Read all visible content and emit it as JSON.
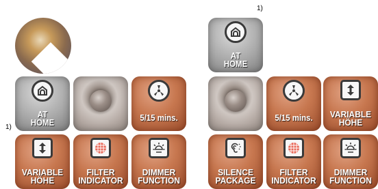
{
  "footnote_mark": "1)",
  "left_group": {
    "tiles": [
      {
        "label_lines": [
          "AT",
          "HOME"
        ],
        "icon": "home-icon"
      },
      {
        "label_lines": [],
        "icon": "knob-photo"
      },
      {
        "label_lines": [
          "5/15 mins."
        ],
        "icon": "fan-icon"
      },
      {
        "label_lines": [
          "VARIABLE",
          "HÖHE"
        ],
        "icon": "up-down-arrow-icon"
      },
      {
        "label_lines": [
          "FILTER",
          "INDICATOR"
        ],
        "icon": "filter-icon"
      },
      {
        "label_lines": [
          "DIMMER",
          "FUNCTION"
        ],
        "icon": "dimmer-icon"
      }
    ]
  },
  "right_group": {
    "tiles": [
      {
        "label_lines": [
          "AT",
          "HOME"
        ],
        "icon": "home-icon"
      },
      {
        "label_lines": [],
        "icon": "knob-photo"
      },
      {
        "label_lines": [
          "5/15 mins."
        ],
        "icon": "fan-icon"
      },
      {
        "label_lines": [
          "VARIABLE",
          "HÖHE"
        ],
        "icon": "up-down-arrow-icon"
      },
      {
        "label_lines": [
          "SILENCE",
          "PACKAGE"
        ],
        "icon": "ear-icon"
      },
      {
        "label_lines": [
          "FILTER",
          "INDICATOR"
        ],
        "icon": "filter-icon"
      },
      {
        "label_lines": [
          "DIMMER",
          "FUNCTION"
        ],
        "icon": "dimmer-icon"
      }
    ]
  }
}
